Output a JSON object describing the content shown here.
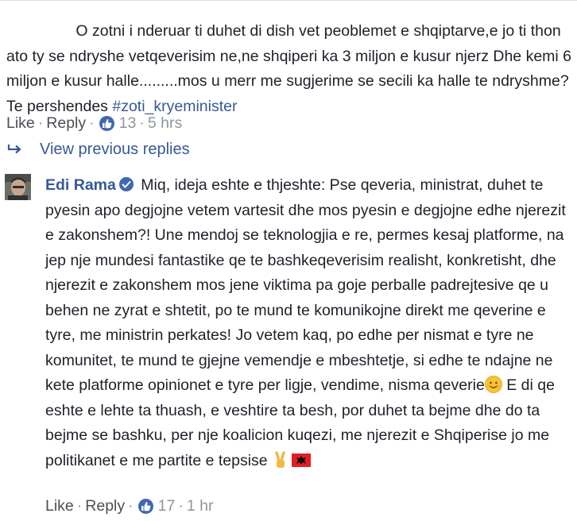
{
  "comment1": {
    "text": "O zotni i nderuar ti duhet di dish vet peoblemet e shqiptarve,e jo ti thon ato ty se ndryshe vetqeverisim ne,ne shqiperi ka 3 miljon e kusur njerz Dhe kemi 6 miljon e kusur halle.........mos u merr me sugjerime se secili ka halle te ndryshme? Te pershendes ",
    "hashtag": "#zoti_kryeminister",
    "actions": {
      "like": "Like",
      "reply": "Reply",
      "reactions": "13",
      "time": "5 hrs"
    }
  },
  "view_previous": "View previous replies",
  "comment2": {
    "author": "Edi Rama",
    "text_part1": "Miq, ideja eshte e thjeshte: Pse qeveria, ministrat, duhet te pyesin apo degjojne vetem vartesit dhe mos pyesin e degjojne edhe njerezit e zakonshem?! Une mendoj se teknologjia e re, permes kesaj platforme, na jep nje mundesi fantastike qe te bashkeqeverisim realisht, konkretisht, dhe njerezit e zakonshem mos jene viktima pa goje perballe padrejtesive qe u behen ne zyrat e shtetit, po te mund te komunikojne direkt me qeverine e tyre, me ministrin perkates! Jo vetem kaq, po edhe per nismat e tyre ne komunitet, te mund te gjejne vemendje e mbeshtetje, si edhe te ndajne ne kete platforme opinionet e tyre per ligje, vendime, nisma qeverie",
    "text_part2": " E di qe eshte e lehte ta thuash, e veshtire ta besh, por duhet ta bejme dhe do ta bejme se bashku, per nje koalicion kuqezi, me njerezit e Shqiperise jo me politikanet e me partite e tepsise",
    "actions": {
      "like": "Like",
      "reply": "Reply",
      "reactions": "17",
      "time": "1 hr"
    }
  },
  "colors": {
    "link": "#365899",
    "text": "#1d2129",
    "meta": "#90949c",
    "like_badge": "#4267b2"
  },
  "icons": [
    "like-icon",
    "reply-arrow-icon",
    "verified-icon",
    "smile-emoji",
    "victory-hand-emoji",
    "albania-flag-emoji"
  ]
}
